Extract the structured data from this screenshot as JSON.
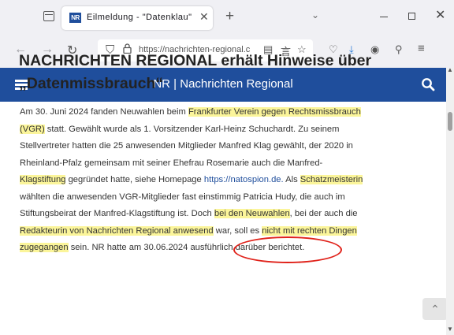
{
  "browser": {
    "tab": {
      "favicon_text": "NR",
      "title": "Eilmeldung - \"Datenklau\"",
      "close_glyph": "✕"
    },
    "new_tab_glyph": "+",
    "tab_list_glyph": "⌄",
    "window_close_glyph": "✕",
    "url": "https://nachrichten-regional.c",
    "icons": [
      "tab-overview-icon",
      "back-icon",
      "forward-icon",
      "reload-icon",
      "shield-icon",
      "lock-icon",
      "reader-view-icon",
      "translate-icon",
      "bookmark-star-icon",
      "pocket-icon",
      "downloads-icon",
      "account-icon",
      "extensions-icon",
      "menu-icon"
    ]
  },
  "site": {
    "header_title": "NR | Nachrichten Regional",
    "header_color": "#1f4e9c",
    "highlight_color": "#fbf59a",
    "annotation_color": "#e0221a"
  },
  "article": {
    "headline_line1": "NACHRICHTEN REGIONAL erhält Hinweise über",
    "headline_line2": "„Datenmissbrauch“",
    "p1_a": "Am 30. Juni 2024 fanden Neuwahlen beim ",
    "p1_hl1": "Frankfurter Verein gegen Rechtsmissbrauch",
    "p1_hl2": "(VGR)",
    "p1_b": " statt. Gewählt wurde als 1. Vorsitzender Karl-Heinz Schuchardt. Zu seinem",
    "p1_c": "Stellvertreter hatten die 25 anwesenden Mitglieder Manfred Klag gewählt, der 2020 in",
    "p1_d": "Rheinland-Pfalz gemeinsam mit seiner Ehefrau Rosemarie auch die Manfred-",
    "p1_hl3": "Klagstiftung",
    "p1_e": " gegründet hatte, siehe Homepage ",
    "p1_link": "https://natospion.de.",
    "p1_f": " Als ",
    "p1_hl4": "Schatzmeisterin",
    "p1_g": "wählten die anwesenden VGR-Mitglieder fast einstimmig Patricia Hudy, die auch im",
    "p1_h": "Stiftungsbeirat der Manfred-Klagstiftung ist. Doch ",
    "p1_hl5": "bei den Neuwahlen",
    "p1_i": ", bei der auch die",
    "p1_hl6": "Redakteurin von Nachrichten Regional anwesend",
    "p1_j": " war, soll es ",
    "p1_hl7": "nicht mit rechten Dingen",
    "p1_hl8": "zugegangen",
    "p1_k": " sein. NR hatte am 30.06.2024 ausführlich darüber berichtet."
  }
}
